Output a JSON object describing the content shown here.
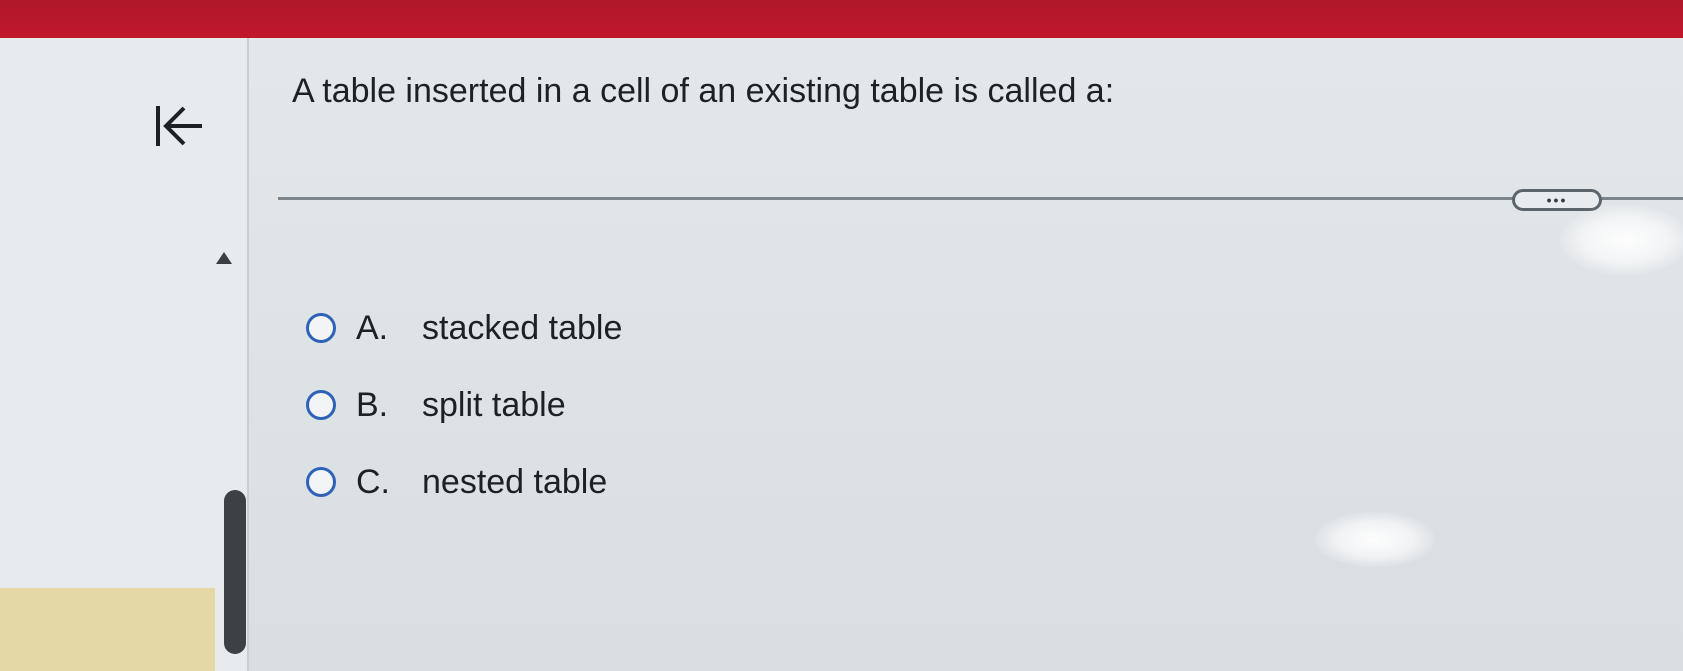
{
  "nav": {
    "collapse_icon": "collapse-left-icon",
    "scroll_up_icon": "scroll-up-icon"
  },
  "question": {
    "text": "A table inserted in a cell of an existing table is called a:"
  },
  "more_button": {
    "label": "•••"
  },
  "options": [
    {
      "letter": "A.",
      "text": "stacked table"
    },
    {
      "letter": "B.",
      "text": "split table"
    },
    {
      "letter": "C.",
      "text": "nested table"
    }
  ],
  "colors": {
    "top_bar": "#c0172c",
    "radio_border": "#2e62b8",
    "text": "#1d2024"
  }
}
